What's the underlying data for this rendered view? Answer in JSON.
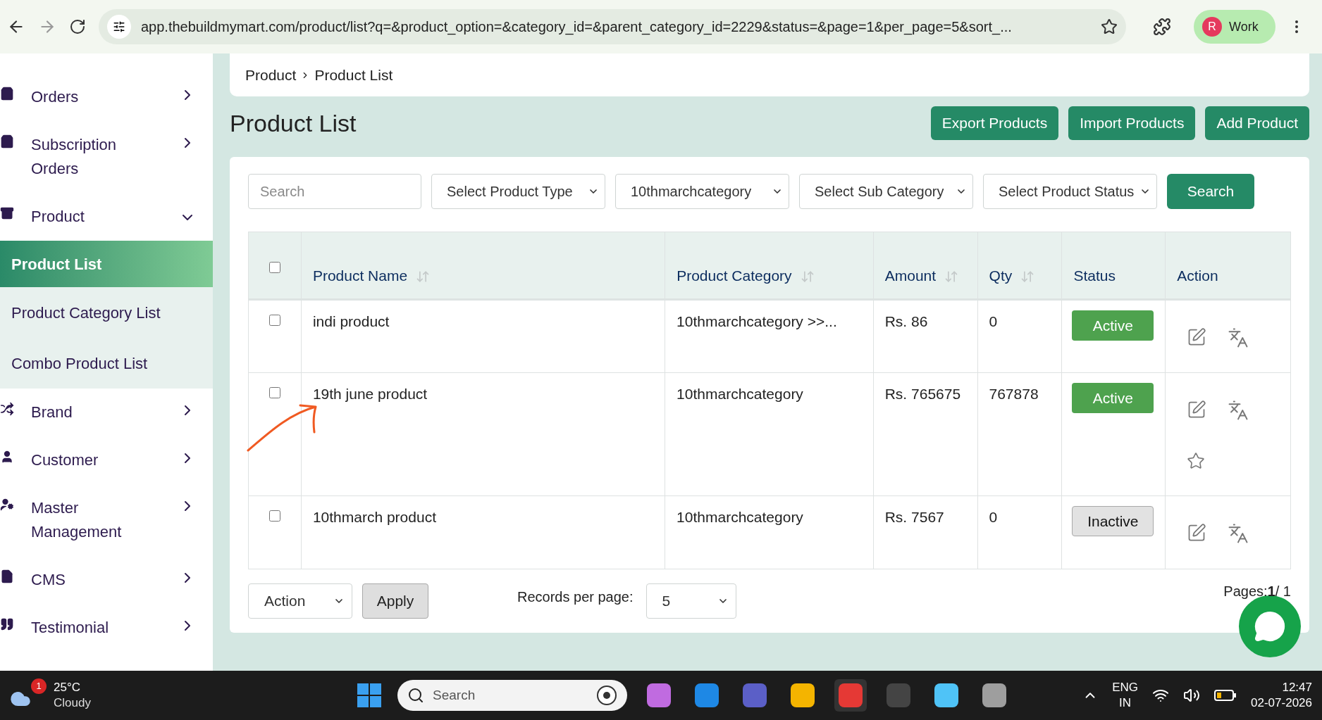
{
  "browser": {
    "url": "app.thebuildmymart.com/product/list?q=&product_option=&category_id=&parent_category_id=2229&status=&page=1&per_page=5&sort_...",
    "profile_initial": "R",
    "profile": "Work"
  },
  "sidebar": {
    "items": [
      {
        "label": "Orders",
        "expanded": false
      },
      {
        "label": "Subscription Orders",
        "expanded": false
      },
      {
        "label": "Product",
        "expanded": true,
        "children": [
          {
            "label": "Product List",
            "selected": true
          },
          {
            "label": "Product Category List",
            "selected": false
          },
          {
            "label": "Combo Product List",
            "selected": false
          }
        ]
      },
      {
        "label": "Brand",
        "expanded": false
      },
      {
        "label": "Customer",
        "expanded": false
      },
      {
        "label": "Master Management",
        "expanded": false
      },
      {
        "label": "CMS",
        "expanded": false
      },
      {
        "label": "Testimonial",
        "expanded": false
      }
    ]
  },
  "breadcrumb": [
    "Product",
    "Product List"
  ],
  "page_title": "Product List",
  "header_buttons": [
    "Export Products",
    "Import Products",
    "Add Product"
  ],
  "filters": {
    "search_placeholder": "Search",
    "selects": [
      "Select Product Type",
      "10thmarchcategory",
      "Select Sub Category",
      "Select Product Status"
    ],
    "search_button": "Search"
  },
  "table": {
    "select_all_checked": false,
    "columns": [
      {
        "label": "Product Name",
        "sortable": true
      },
      {
        "label": "Product Category",
        "sortable": true
      },
      {
        "label": "Amount",
        "sortable": true
      },
      {
        "label": "Qty",
        "sortable": true
      },
      {
        "label": "Status",
        "sortable": false
      },
      {
        "label": "Action",
        "sortable": false
      }
    ],
    "rows": [
      {
        "checked": false,
        "name": "indi product",
        "category": "10thmarchcategory >>...",
        "amount": "Rs. 86",
        "qty": "0",
        "status": {
          "label": "Active",
          "active": true
        },
        "featured_action": false
      },
      {
        "checked": false,
        "name": "19th june product",
        "category": "10thmarchcategory",
        "amount": "Rs. 765675",
        "qty": "767878",
        "status": {
          "label": "Active",
          "active": true
        },
        "featured_action": true
      },
      {
        "checked": false,
        "name": "10thmarch product",
        "category": "10thmarchcategory",
        "amount": "Rs. 7567",
        "qty": "0",
        "status": {
          "label": "Inactive",
          "active": false
        },
        "featured_action": false
      }
    ]
  },
  "footer": {
    "bulk_action": "Action",
    "apply": "Apply",
    "records_label": "Records per page:",
    "per_page": "5",
    "pages": "Pages:**1**/ 1"
  },
  "taskbar": {
    "weather_badge": "1",
    "temperature": "25°C",
    "condition": "Cloudy",
    "search_placeholder": "Search",
    "language": "ENG",
    "region": "IN",
    "time": "12:47",
    "date": "02-07-2026"
  }
}
